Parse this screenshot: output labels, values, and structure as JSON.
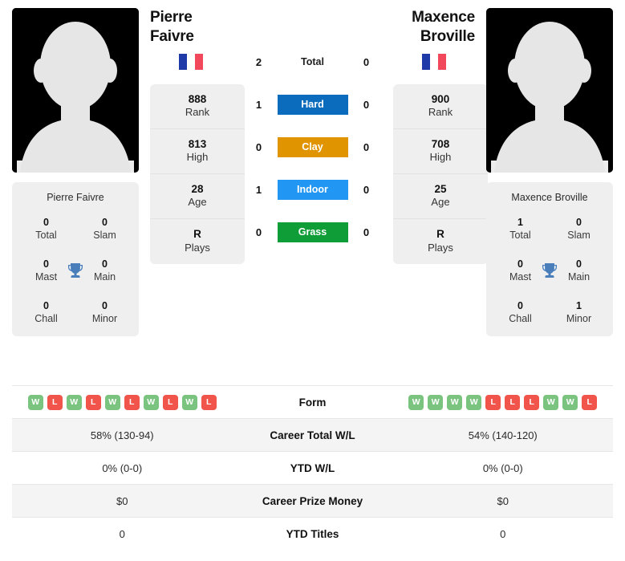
{
  "players": {
    "left": {
      "name": "Pierre Faivre",
      "flag": "FR",
      "photo_alt": "player-avatar-placeholder",
      "card_name": "Pierre Faivre",
      "titles": [
        {
          "num": "0",
          "label": "Total"
        },
        {
          "num": "0",
          "label": "Slam"
        },
        {
          "num": "0",
          "label": "Mast"
        },
        {
          "num": "0",
          "label": "Main"
        },
        {
          "num": "0",
          "label": "Chall"
        },
        {
          "num": "0",
          "label": "Minor"
        }
      ],
      "info": [
        {
          "num": "888",
          "label": "Rank"
        },
        {
          "num": "813",
          "label": "High"
        },
        {
          "num": "28",
          "label": "Age"
        },
        {
          "num": "R",
          "label": "Plays"
        }
      ],
      "form": [
        "W",
        "L",
        "W",
        "L",
        "W",
        "L",
        "W",
        "L",
        "W",
        "L"
      ],
      "career_total_wl": "58% (130-94)",
      "ytd_wl": "0% (0-0)",
      "career_prize_money": "$0",
      "ytd_titles": "0"
    },
    "right": {
      "name": "Maxence Broville",
      "flag": "FR",
      "photo_alt": "player-avatar-placeholder",
      "card_name": "Maxence Broville",
      "titles": [
        {
          "num": "1",
          "label": "Total"
        },
        {
          "num": "0",
          "label": "Slam"
        },
        {
          "num": "0",
          "label": "Mast"
        },
        {
          "num": "0",
          "label": "Main"
        },
        {
          "num": "0",
          "label": "Chall"
        },
        {
          "num": "1",
          "label": "Minor"
        }
      ],
      "info": [
        {
          "num": "900",
          "label": "Rank"
        },
        {
          "num": "708",
          "label": "High"
        },
        {
          "num": "25",
          "label": "Age"
        },
        {
          "num": "R",
          "label": "Plays"
        }
      ],
      "form": [
        "W",
        "W",
        "W",
        "W",
        "L",
        "L",
        "L",
        "W",
        "W",
        "L"
      ],
      "career_total_wl": "54% (140-120)",
      "ytd_wl": "0% (0-0)",
      "career_prize_money": "$0",
      "ytd_titles": "0"
    }
  },
  "h2h": {
    "rows": [
      {
        "label": "Total",
        "left": "2",
        "right": "0",
        "color": "none"
      },
      {
        "label": "Hard",
        "left": "1",
        "right": "0",
        "color": "#0b6bbd"
      },
      {
        "label": "Clay",
        "left": "0",
        "right": "0",
        "color": "#e09400"
      },
      {
        "label": "Indoor",
        "left": "1",
        "right": "0",
        "color": "#2196f3"
      },
      {
        "label": "Grass",
        "left": "0",
        "right": "0",
        "color": "#0f9d38"
      }
    ]
  },
  "table": {
    "rows": [
      {
        "label": "Form",
        "type": "form"
      },
      {
        "label": "Career Total W/L",
        "type": "text",
        "left": "58% (130-94)",
        "right": "54% (140-120)"
      },
      {
        "label": "YTD W/L",
        "type": "text",
        "left": "0% (0-0)",
        "right": "0% (0-0)"
      },
      {
        "label": "Career Prize Money",
        "type": "text",
        "left": "$0",
        "right": "$0"
      },
      {
        "label": "YTD Titles",
        "type": "text",
        "left": "0",
        "right": "0"
      }
    ]
  },
  "colors": {
    "hard": "#0b6bbd",
    "clay": "#e09400",
    "indoor": "#2196f3",
    "grass": "#0f9d38",
    "win": "#7ac47f",
    "loss": "#f0544a",
    "card_bg": "#efefef",
    "trophy": "#4a7ebb"
  }
}
